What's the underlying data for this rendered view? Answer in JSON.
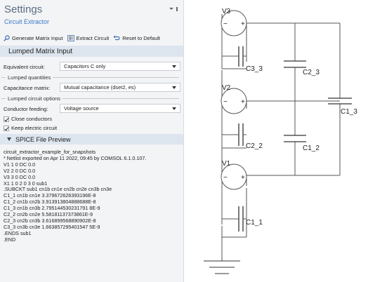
{
  "panel": {
    "title": "Settings",
    "subtitle": "Circuit Extractor",
    "menu_icon": "pin-menu-icon"
  },
  "toolbar": {
    "generate_label": "Generate Matrix Input",
    "extract_label": "Extract Circuit",
    "reset_label": "Reset to Default",
    "icons": [
      "search-icon",
      "extract-circuit-icon",
      "reset-arrow-icon"
    ]
  },
  "lumped_section": {
    "title": "Lumped Matrix Input",
    "equivalent_circuit_label": "Equivalent circuit:",
    "equivalent_circuit_value": "Capacitors C only",
    "lumped_quantities_label": "Lumped quantities",
    "capacitance_matrix_label": "Capacitance matrix:",
    "capacitance_matrix_value": "Mutual  capacitance (dset2, es)",
    "lumped_options_label": "Lumped circuit options",
    "conductor_feeding_label": "Conductor feeding:",
    "conductor_feeding_value": "Voltage source",
    "close_conductors_label": "Close conductors",
    "close_conductors_checked": true,
    "keep_electric_label": "Keep electric circuit",
    "keep_electric_checked": true
  },
  "spice_section": {
    "title": "SPICE File Preview",
    "lines": [
      "circuit_extractor_example_for_snapshots",
      "* Netlist exported on Apr 11 2022, 09:45 by COMSOL 6.1.0.107.",
      "V1 1 0 DC 0.0",
      "V2 2 0 DC 0.0",
      "V3 3 0 DC 0.0",
      "X1 1 0 2 0 3 0 sub1",
      ".SUBCKT sub1 cn1b cn1e cn2b cn2e cn3b cn3e",
      "C1_1 cn1b cn1e 3.379672626393196E-8",
      "C1_2 cn1b cn2b 3.913913804888688E-8",
      "C1_3 cn1b cn3b 2.795144530231791 8E-9",
      "C2_2 cn2b cn2e 5.58181137373861E-9",
      "C2_3 cn2b cn3b 3.616899568890902E-8",
      "C3_3 cn3b cn3e 1.663857295401547 5E-9",
      ".ENDS sub1",
      ".END"
    ]
  },
  "schematic": {
    "labels": {
      "v3": "V3",
      "v2": "V2",
      "v1": "V1",
      "c3_3": "C3_3",
      "c2_3": "C2_3",
      "c1_3": "C1_3",
      "c2_2": "C2_2",
      "c1_2": "C1_2",
      "c1_1": "C1_1"
    },
    "minus": "−",
    "plus": "+"
  }
}
